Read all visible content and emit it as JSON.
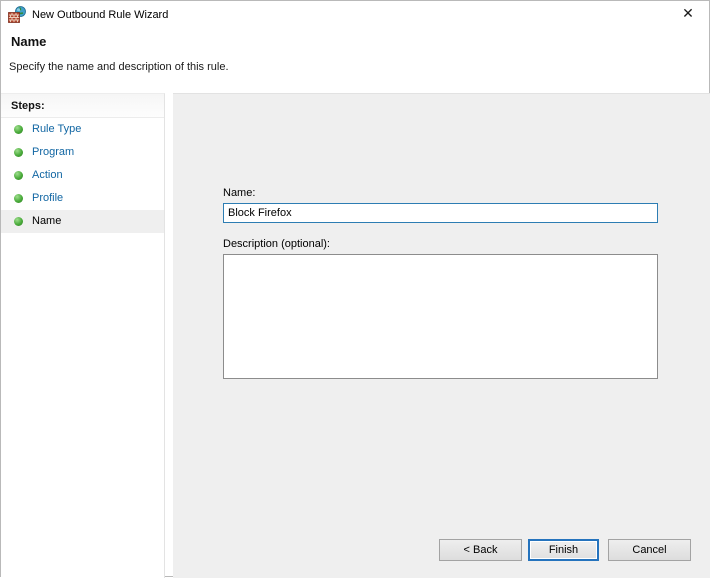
{
  "window": {
    "title": "New Outbound Rule Wizard"
  },
  "icons": {
    "close": "✕"
  },
  "header": {
    "title": "Name",
    "subtitle": "Specify the name and description of this rule."
  },
  "sidebar": {
    "heading": "Steps:",
    "items": [
      {
        "label": "Rule Type",
        "active": false
      },
      {
        "label": "Program",
        "active": false
      },
      {
        "label": "Action",
        "active": false
      },
      {
        "label": "Profile",
        "active": false
      },
      {
        "label": "Name",
        "active": true
      }
    ]
  },
  "form": {
    "name_label": "Name:",
    "name_value": "Block Firefox",
    "description_label": "Description (optional):",
    "description_value": ""
  },
  "buttons": {
    "back": "< Back",
    "finish": "Finish",
    "cancel": "Cancel"
  },
  "colors": {
    "accent_input_border": "#2d7db3",
    "focus_ring": "#2573bd",
    "step_link": "#1166a3",
    "bullet_green": "#4aab3b",
    "panel_bg": "#efefef"
  }
}
